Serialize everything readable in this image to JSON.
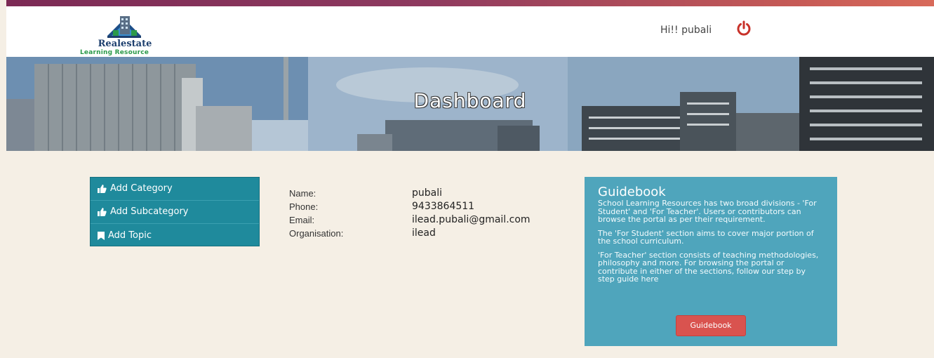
{
  "header": {
    "logo_title": "Realestate",
    "logo_subtitle": "Learning Resource",
    "greeting": "Hi!! pubali",
    "logout_icon": "power-icon",
    "stripe_colors": [
      "#7c2a55",
      "#d86a5a"
    ]
  },
  "banner": {
    "title": "Dashboard"
  },
  "sidebar": {
    "items": [
      {
        "label": "Add Category",
        "icon": "thumbs-up-icon"
      },
      {
        "label": "Add Subcategory",
        "icon": "thumbs-up-icon"
      },
      {
        "label": "Add Topic",
        "icon": "bookmark-icon"
      }
    ],
    "background": "#1f8a9c"
  },
  "profile": {
    "rows": [
      {
        "label": "Name:",
        "value": "pubali"
      },
      {
        "label": "Phone:",
        "value": "9433864511"
      },
      {
        "label": "Email:",
        "value": "ilead.pubali@gmail.com"
      },
      {
        "label": "Organisation:",
        "value": "ilead"
      }
    ]
  },
  "guidebook": {
    "title": "Guidebook",
    "paragraphs": [
      "School Learning Resources has two broad divisions - 'For Student' and 'For Teacher'. Users or contributors can browse the portal as per their requirement.",
      "The 'For Student' section aims to cover major portion of the school curriculum.",
      "'For Teacher' section consists of teaching methodologies, philosophy and more. For browsing the portal or contribute in either of the sections, follow our step by step guide here"
    ],
    "button_label": "Guidebook",
    "background": "#4fa5bc",
    "button_color": "#d9534f"
  }
}
